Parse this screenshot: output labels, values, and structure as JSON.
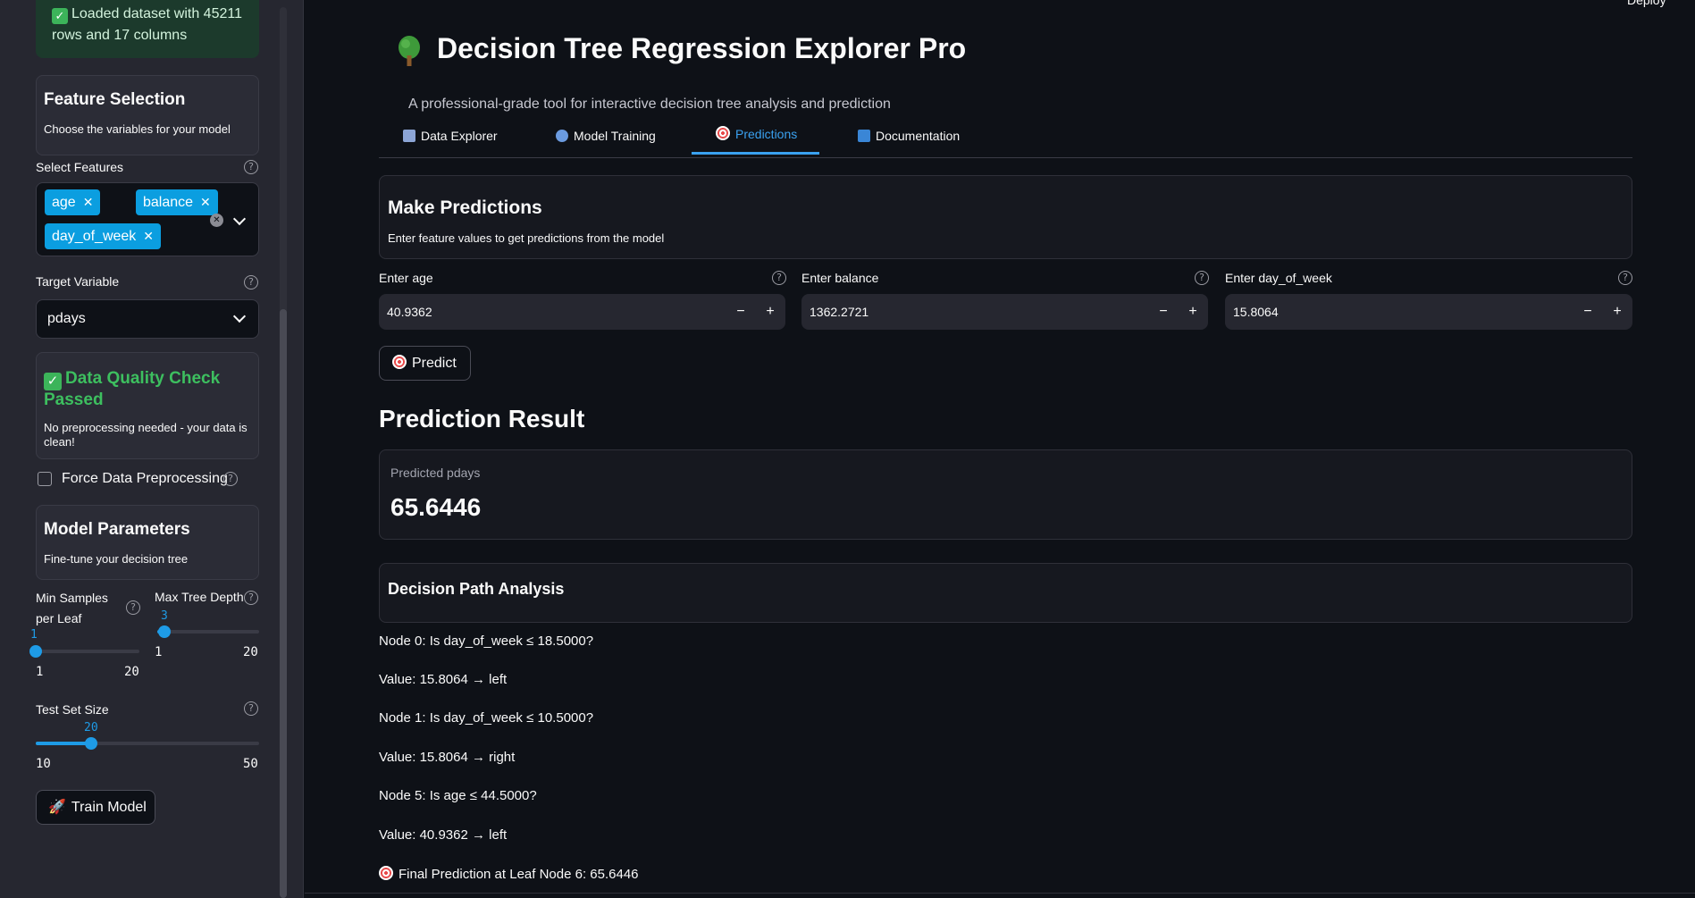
{
  "app": {
    "title": "Decision Tree Regression Explorer Pro",
    "subtitle": "A professional-grade tool for interactive decision tree analysis and prediction",
    "deploy_label": "Deploy"
  },
  "sidebar": {
    "success_message": "Loaded dataset with 45211 rows and 17 columns",
    "feature_selection": {
      "title": "Feature Selection",
      "description": "Choose the variables for your model"
    },
    "select_features_label": "Select Features",
    "selected_features": [
      "age",
      "balance",
      "day_of_week"
    ],
    "target_label": "Target Variable",
    "target_value": "pdays",
    "data_quality": {
      "title": "Data Quality Check Passed",
      "description": "No preprocessing needed - your data is clean!"
    },
    "force_preprocessing_label": "Force Data Preprocessing",
    "model_parameters": {
      "title": "Model Parameters",
      "description": "Fine-tune your decision tree"
    },
    "min_samples": {
      "label": "Min Samples per Leaf",
      "value": "1",
      "min": "1",
      "max": "20",
      "level": 0.0
    },
    "max_depth": {
      "label": "Max Tree Depth",
      "value": "3",
      "min": "1",
      "max": "20",
      "level": 0.105
    },
    "test_size": {
      "label": "Test Set Size",
      "value": "20",
      "min": "10",
      "max": "50",
      "level": 0.25
    },
    "train_button": "Train Model"
  },
  "tabs": [
    {
      "label": "Data Explorer",
      "icon": "bar-chart-icon",
      "active": false
    },
    {
      "label": "Model Training",
      "icon": "magnifier-icon",
      "active": false
    },
    {
      "label": "Predictions",
      "icon": "target-icon",
      "active": true
    },
    {
      "label": "Documentation",
      "icon": "info-icon",
      "active": false
    }
  ],
  "predictions": {
    "title": "Make Predictions",
    "description": "Enter feature values to get predictions from the model",
    "inputs": [
      {
        "label": "Enter age",
        "value": "40.9362"
      },
      {
        "label": "Enter balance",
        "value": "1362.2721"
      },
      {
        "label": "Enter day_of_week",
        "value": "15.8064"
      }
    ],
    "predict_button": "Predict"
  },
  "result": {
    "heading": "Prediction Result",
    "metric_label": "Predicted pdays",
    "metric_value": "65.6446",
    "path_title": "Decision Path Analysis",
    "path_lines": [
      "Node 0: Is day_of_week ≤ 18.5000?",
      "Value: 15.8064 → left",
      "Node 1: Is day_of_week ≤ 10.5000?",
      "Value: 15.8064 → right",
      "Node 5: Is age ≤ 44.5000?",
      "Value: 40.9362 → left",
      "Final Prediction at Leaf Node 6: 65.6446"
    ]
  },
  "colors": {
    "accent": "#1e9be6",
    "tag": "#0b9ee0",
    "success": "#3dbf5f",
    "background": "#0e1117",
    "sidebar": "#262730"
  }
}
